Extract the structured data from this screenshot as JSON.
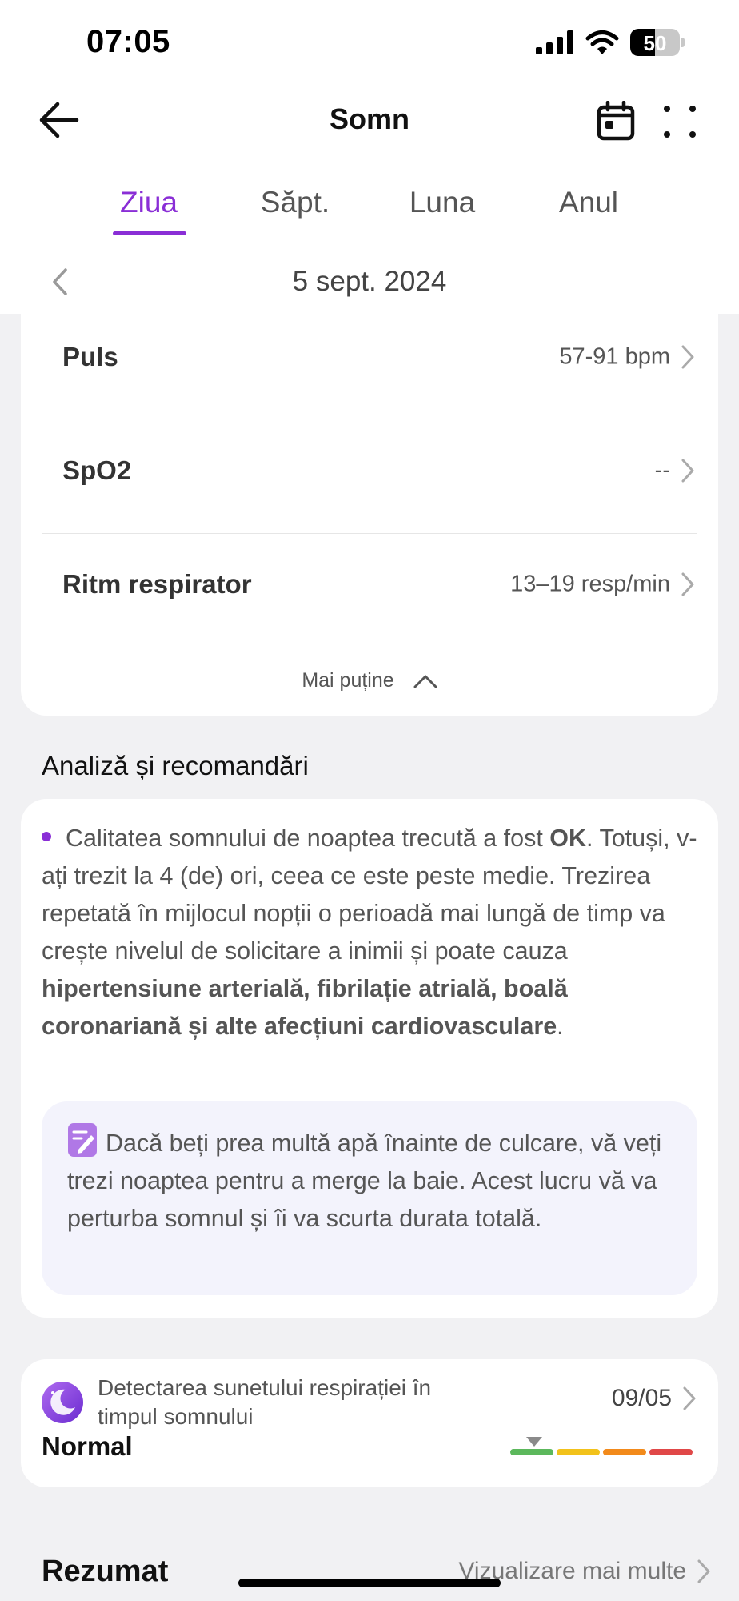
{
  "status_bar": {
    "time": "07:05",
    "battery_level": "50",
    "icons": [
      "signal-icon",
      "wifi-icon",
      "battery-icon"
    ]
  },
  "header": {
    "title": "Somn",
    "icons": [
      "back-arrow-icon",
      "calendar-icon",
      "more-grid-icon"
    ]
  },
  "tabs": [
    {
      "label": "Ziua",
      "active": true
    },
    {
      "label": "Săpt.",
      "active": false
    },
    {
      "label": "Luna",
      "active": false
    },
    {
      "label": "Anul",
      "active": false
    }
  ],
  "date_nav": {
    "date": "5 sept. 2024"
  },
  "metrics": [
    {
      "label": "Puls",
      "value": "57-91 bpm"
    },
    {
      "label": "SpO2",
      "value": "--"
    },
    {
      "label": "Ritm respirator",
      "value": "13–19 resp/min"
    }
  ],
  "collapse_label": "Mai puține",
  "analysis": {
    "section_title": "Analiză și recomandări",
    "text_1": "Calitatea somnului de noaptea trecută a fost ",
    "bold_1": "OK",
    "text_2": ". Totuși, v-ați trezit la 4 (de) ori, ceea ce este peste medie. Trezirea repetată în mijlocul nopții o perioadă mai lungă de timp va crește nivelul de solicitare a inimii și poate cauza ",
    "bold_2": "hipertensiune arterială, fibrilație atrială, boală coronariană și alte afecțiuni cardiovasculare",
    "text_3": ".",
    "tip": "Dacă beți prea multă apă înainte de culcare, vă veți trezi noaptea pentru a merge la baie. Acest lucru vă va perturba somnul și îi va scurta durata totală."
  },
  "breathing": {
    "title": "Detectarea sunetului respirației în timpul somnului",
    "status": "Normal",
    "date": "09/05",
    "scale_colors": [
      "#5cb85c",
      "#f2c21b",
      "#f28a1b",
      "#e04848"
    ]
  },
  "summary": {
    "title": "Rezumat",
    "more_label": "Vizualizare mai multe"
  },
  "colors": {
    "accent": "#8a2ed6",
    "background": "#f1f1f3"
  }
}
